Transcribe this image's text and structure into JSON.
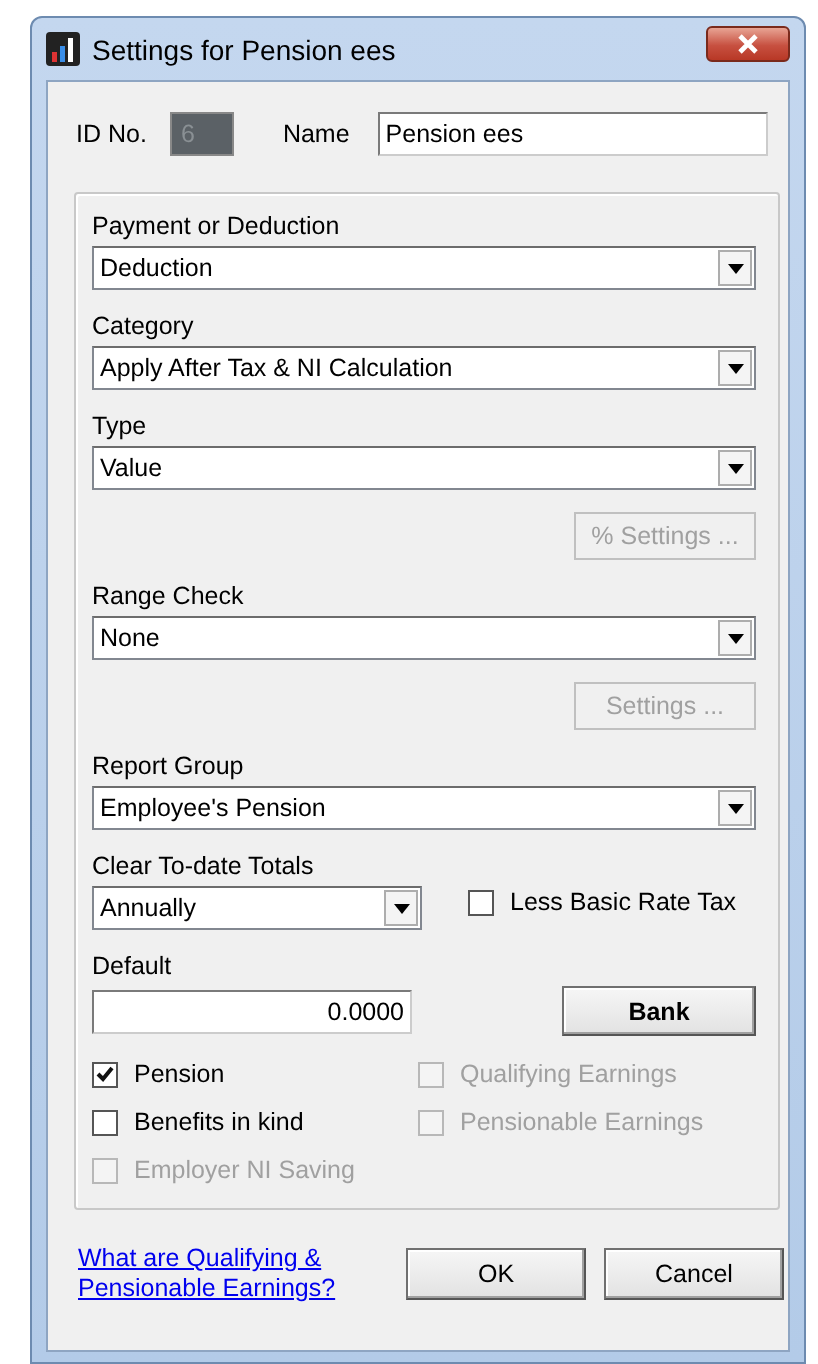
{
  "window": {
    "title": "Settings for Pension ees"
  },
  "id_no": {
    "label": "ID No.",
    "value": "6",
    "disabled": true
  },
  "name": {
    "label": "Name",
    "value": "Pension ees"
  },
  "fields": [
    {
      "kind": "dropdown",
      "label": "Payment or Deduction",
      "value": "Deduction"
    },
    {
      "kind": "dropdown",
      "label": "Category",
      "value": "Apply After Tax & NI Calculation"
    },
    {
      "kind": "dropdown",
      "label": "Type",
      "value": "Value"
    },
    {
      "kind": "button",
      "label": "% Settings ...",
      "disabled": true
    },
    {
      "kind": "dropdown",
      "label": "Range Check",
      "value": "None"
    },
    {
      "kind": "button",
      "label": "Settings ...",
      "disabled": true
    },
    {
      "kind": "dropdown",
      "label": "Report Group",
      "value": "Employee's Pension"
    }
  ],
  "clear_totals": {
    "label": "Clear To-date Totals",
    "value": "Annually"
  },
  "less_basic_rate_tax": {
    "label": "Less Basic Rate Tax",
    "checked": false,
    "disabled": false
  },
  "default": {
    "label": "Default",
    "value": "0.0000"
  },
  "bank_button": {
    "label": "Bank",
    "disabled": false
  },
  "checkboxes": [
    {
      "label": "Pension",
      "checked": true,
      "disabled": false
    },
    {
      "label": "Qualifying Earnings",
      "checked": false,
      "disabled": true
    },
    {
      "label": "Benefits in kind",
      "checked": false,
      "disabled": false
    },
    {
      "label": "Pensionable Earnings",
      "checked": false,
      "disabled": true
    },
    {
      "label": "Employer NI Saving",
      "checked": false,
      "disabled": true
    }
  ],
  "help_link": "What are Qualifying & Pensionable Earnings?",
  "buttons": [
    {
      "label": "OK",
      "disabled": false
    },
    {
      "label": "Cancel",
      "disabled": false
    }
  ]
}
